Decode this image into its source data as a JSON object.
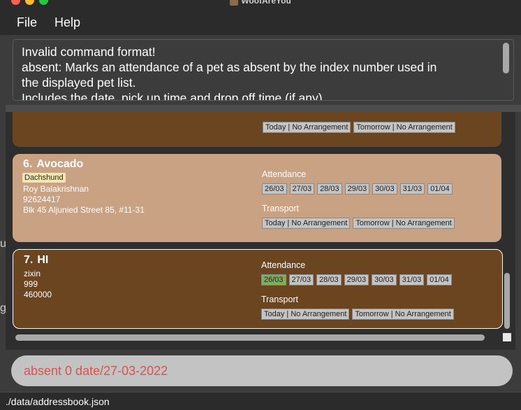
{
  "window": {
    "title": "WoofAreYou"
  },
  "menu": {
    "file": "File",
    "help": "Help"
  },
  "result": {
    "lines": [
      "Invalid command format!",
      "absent: Marks an attendance of a pet as absent by the index number used in",
      "the displayed pet list.",
      "Includes the date, pick up time and drop off time (if any)"
    ]
  },
  "top_card": {
    "transport": [
      "Today | No Arrangement",
      "Tomorrow | No Arrangement"
    ]
  },
  "pets": [
    {
      "index": "6.",
      "name": "Avocado",
      "breed": "Dachshund",
      "owner": "Roy Balakrishnan",
      "phone": "92624417",
      "address": "Blk 45 Aljunied Street 85, #11-31",
      "attendance_label": "Attendance",
      "attendance": [
        "26/03",
        "27/03",
        "28/03",
        "29/03",
        "30/03",
        "31/03",
        "01/04"
      ],
      "transport_label": "Transport",
      "transport": [
        "Today | No Arrangement",
        "Tomorrow | No Arrangement"
      ]
    },
    {
      "index": "7.",
      "name": "HI",
      "owner": "zixin",
      "phone": "999",
      "address": "460000",
      "attendance_label": "Attendance",
      "attendance": [
        "26/03",
        "27/03",
        "28/03",
        "29/03",
        "30/03",
        "31/03",
        "01/04"
      ],
      "present": [
        "26/03"
      ],
      "transport_label": "Transport",
      "transport": [
        "Today | No Arrangement",
        "Tomorrow | No Arrangement"
      ]
    }
  ],
  "command": {
    "value": "absent 0 date/27-03-2022"
  },
  "status": {
    "path": "./data/addressbook.json"
  },
  "colors": {
    "card_dark": "#6b4420",
    "card_light": "#c9a283",
    "present_chip": "#7fae5a",
    "command_text": "#d9534f"
  }
}
